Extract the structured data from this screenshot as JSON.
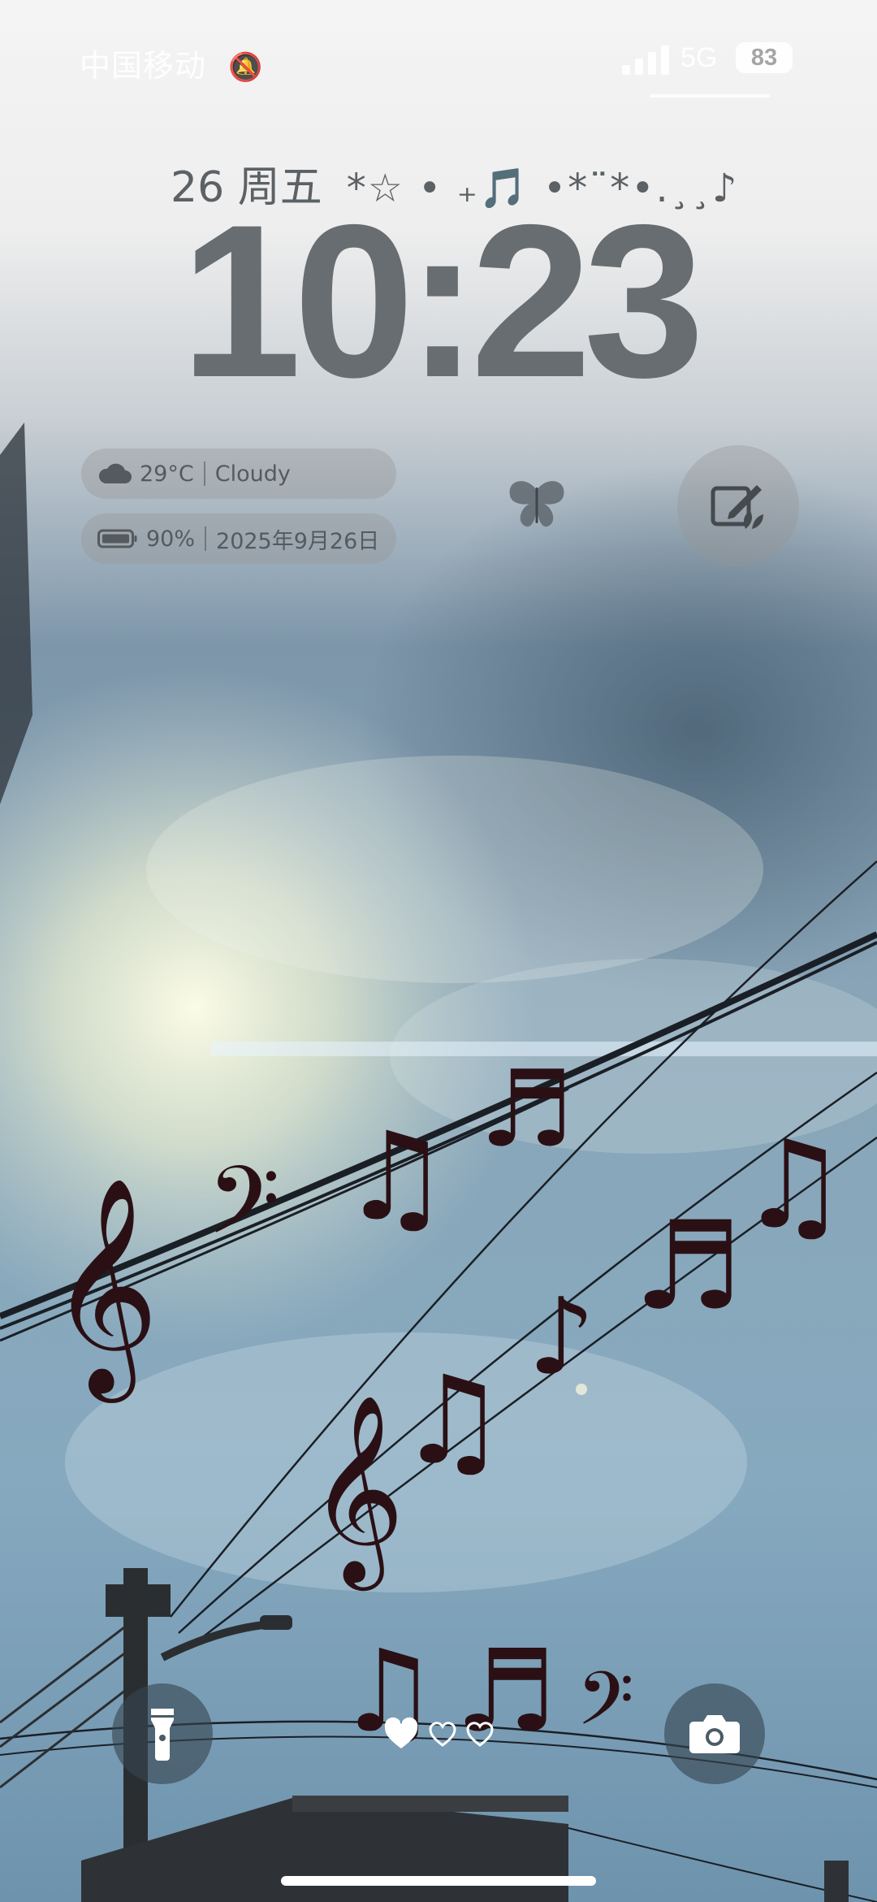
{
  "status_bar": {
    "carrier": "中国移动",
    "mute_icon": "bell-slash-icon",
    "network": "5G",
    "battery_level": "83",
    "signal_icon": "cellular-signal-icon"
  },
  "lock_screen": {
    "date": "26 周五",
    "date_decoration": "*☆ • ₊🎵 •*¨*•.¸¸♪",
    "time": "10:23"
  },
  "widgets": {
    "weather": {
      "icon": "cloud-icon",
      "temperature": "29°C",
      "condition": "Cloudy"
    },
    "battery": {
      "icon": "battery-icon",
      "level": "90%",
      "date": "2025年9月26日"
    },
    "butterfly_icon": "butterfly-icon",
    "edit_widget_icon": "edit-widget-icon"
  },
  "bottom": {
    "flashlight_icon": "flashlight-icon",
    "camera_icon": "camera-icon",
    "page_indicator": {
      "icon": "heart-icon",
      "count": 3,
      "active_index": 0
    }
  },
  "colors": {
    "time_text": "#686d71",
    "widget_bg": "rgba(150,150,150,0.38)",
    "note_color": "#2a1014"
  }
}
